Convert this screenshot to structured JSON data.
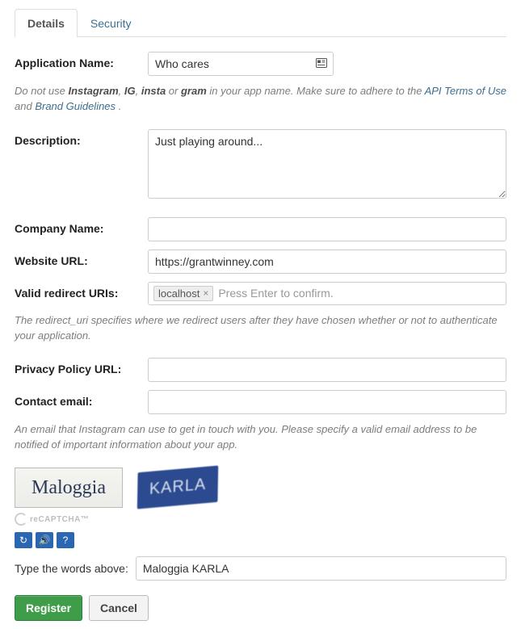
{
  "tabs": [
    {
      "label": "Details",
      "active": true
    },
    {
      "label": "Security",
      "active": false
    }
  ],
  "form": {
    "app_name": {
      "label": "Application Name:",
      "value": "Who cares"
    },
    "app_name_hint": {
      "prefix": "Do not use ",
      "bold": [
        "Instagram",
        "IG",
        "insta",
        "gram"
      ],
      "middle": " in your app name. Make sure to adhere to the ",
      "link1": "API Terms of Use",
      "and": " and ",
      "link2": "Brand Guidelines",
      "suffix": " ."
    },
    "description": {
      "label": "Description:",
      "value": "Just playing around..."
    },
    "company": {
      "label": "Company Name:",
      "value": ""
    },
    "website": {
      "label": "Website URL:",
      "value": "https://grantwinney.com"
    },
    "redirect": {
      "label": "Valid redirect URIs:",
      "tag": "localhost",
      "placeholder": "Press Enter to confirm."
    },
    "redirect_hint": "The redirect_uri specifies where we redirect users after they have chosen whether or not to authenticate your application.",
    "privacy": {
      "label": "Privacy Policy URL:",
      "value": ""
    },
    "contact": {
      "label": "Contact email:",
      "value": ""
    },
    "contact_hint": "An email that Instagram can use to get in touch with you. Please specify a valid email address to be notified of important information about your app."
  },
  "captcha": {
    "word1": "Maloggia",
    "word2": "KARLA",
    "brand": "reCAPTCHA™",
    "input_label": "Type the words above:",
    "input_value": "Maloggia KARLA"
  },
  "buttons": {
    "register": "Register",
    "cancel": "Cancel"
  }
}
